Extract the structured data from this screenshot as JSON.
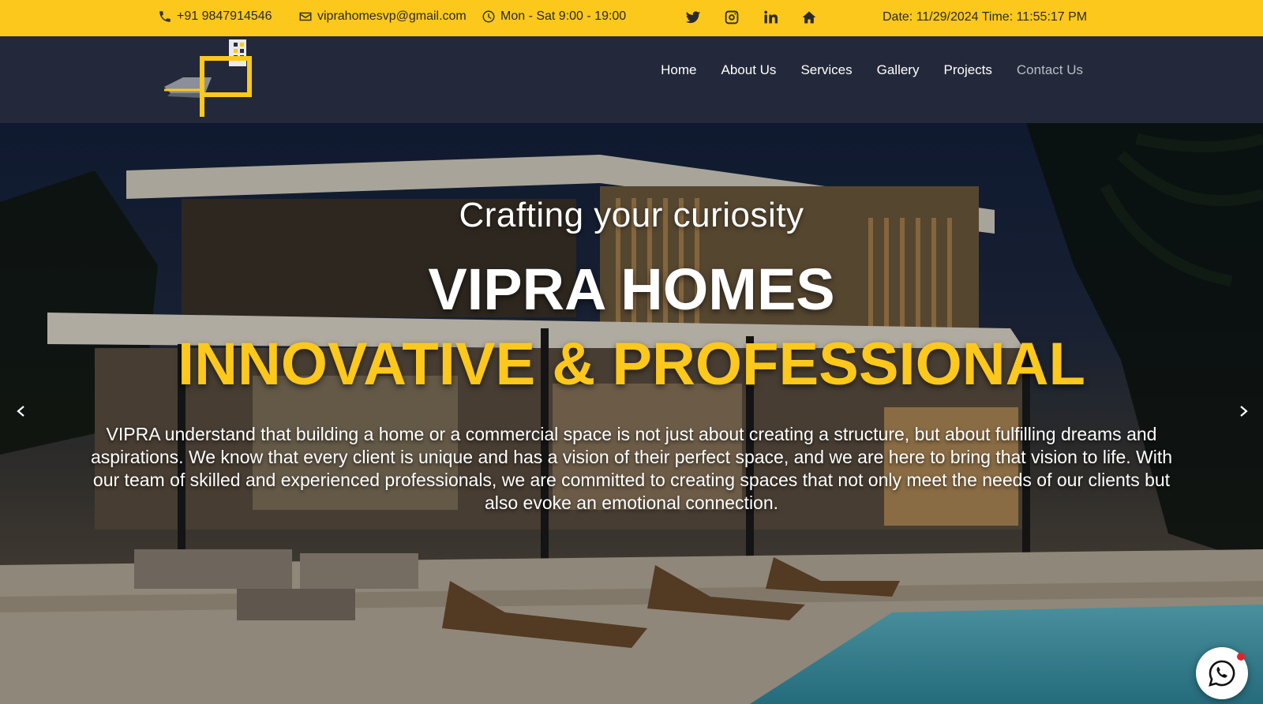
{
  "topbar": {
    "phone": "+91 9847914546",
    "email": "viprahomesvp@gmail.com",
    "hours": "Mon - Sat 9:00 - 19:00",
    "social": [
      "twitter-icon",
      "instagram-icon",
      "linkedin-icon",
      "home-icon"
    ],
    "datetime": "Date: 11/29/2024 Time: 11:55:17 PM"
  },
  "nav": {
    "items": [
      "Home",
      "About Us",
      "Services",
      "Gallery",
      "Projects",
      "Contact Us"
    ]
  },
  "hero": {
    "subtitle": "Crafting your curiosity",
    "title": "VIPRA HOMES",
    "tagline": "INNOVATIVE & PROFESSIONAL",
    "description": "VIPRA understand that building a home or a commercial space is not just about creating a structure, but about fulfilling dreams and aspirations. We know that every client is unique and has a vision of their perfect space, and we are here to bring that vision to life. With our team of skilled and experienced professionals, we are committed to creating spaces that not only meet the needs of our clients but also evoke an emotional connection."
  },
  "colors": {
    "accent": "#fcc81b",
    "navbar": "#23283a",
    "whatsapp": "#25d366"
  }
}
